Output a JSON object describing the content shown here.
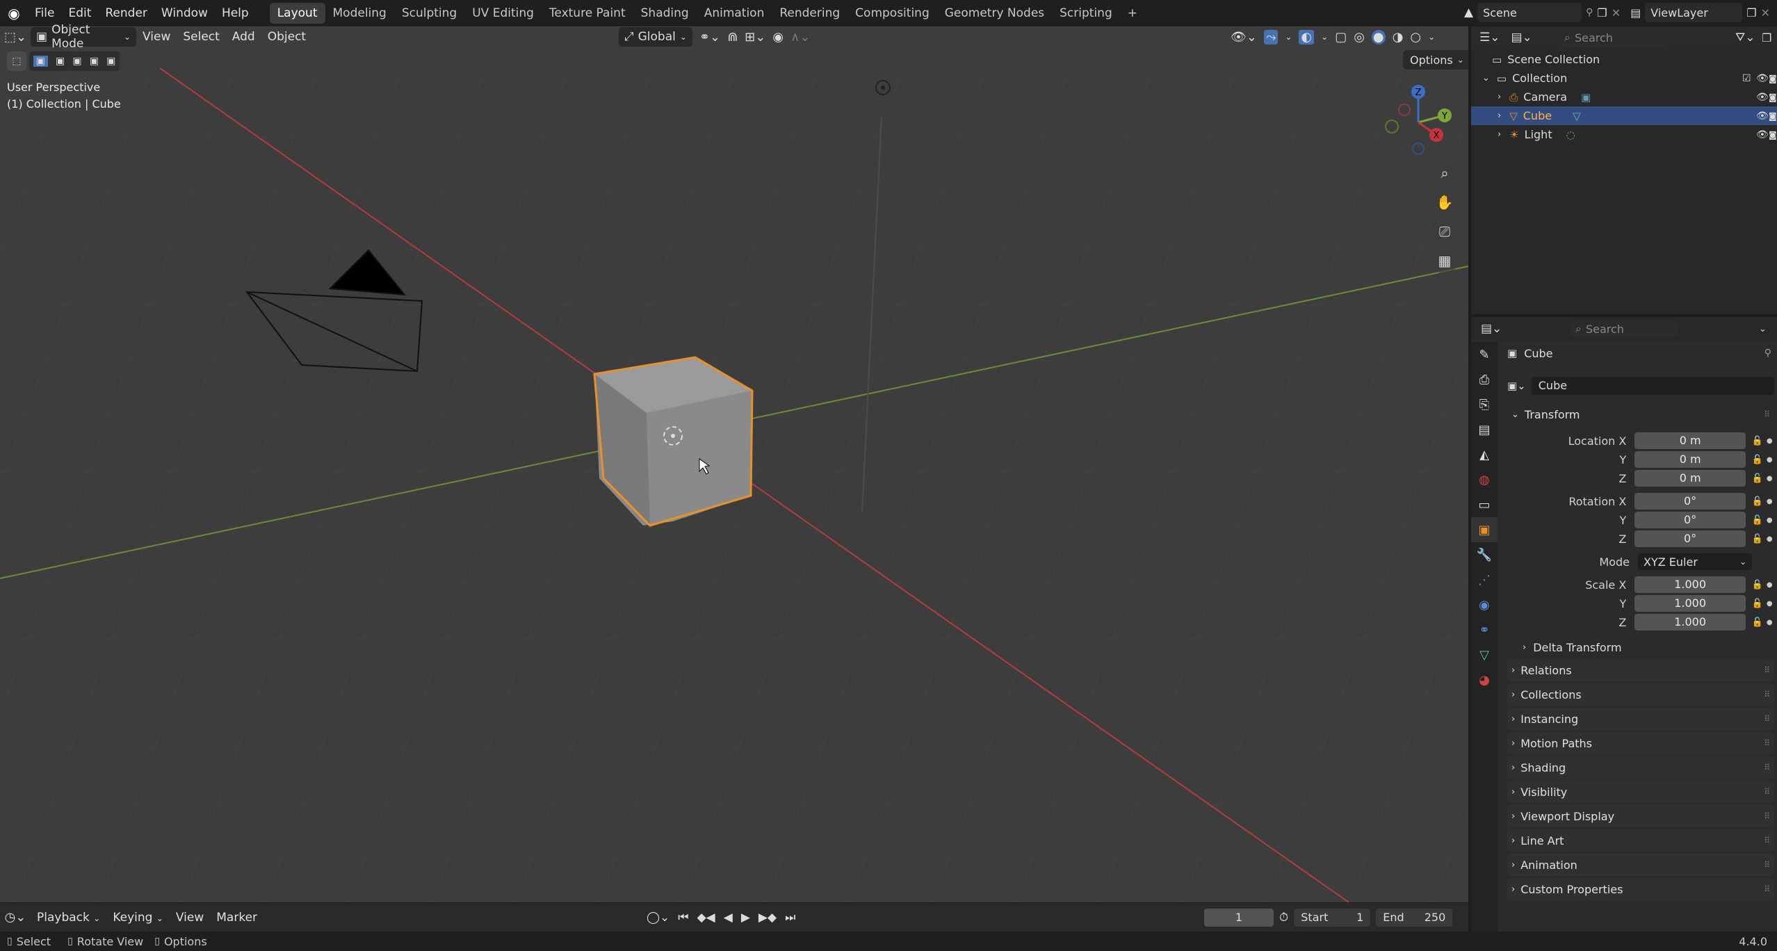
{
  "topbar": {
    "menus": [
      "File",
      "Edit",
      "Render",
      "Window",
      "Help"
    ],
    "workspaces": [
      "Layout",
      "Modeling",
      "Sculpting",
      "UV Editing",
      "Texture Paint",
      "Shading",
      "Animation",
      "Rendering",
      "Compositing",
      "Geometry Nodes",
      "Scripting"
    ],
    "active_workspace": "Layout",
    "add_tab": "+",
    "scene": "Scene",
    "view_layer": "ViewLayer"
  },
  "viewport": {
    "mode": "Object Mode",
    "menus": [
      "View",
      "Select",
      "Add",
      "Object"
    ],
    "orientation": "Global",
    "options": "Options",
    "perspective": "User Perspective",
    "collection_info": "(1) Collection | Cube",
    "gizmo": {
      "z": "Z",
      "y": "Y",
      "x": "X"
    }
  },
  "timeline": {
    "menus": [
      "Playback",
      "Keying",
      "View",
      "Marker"
    ],
    "current_frame": "1",
    "start_label": "Start",
    "start": "1",
    "end_label": "End",
    "end": "250"
  },
  "status": {
    "select": "Select",
    "rotate": "Rotate View",
    "options": "Options",
    "version": "4.4.0"
  },
  "outliner": {
    "search_placeholder": "Search",
    "root": "Scene Collection",
    "collection": "Collection",
    "items": [
      {
        "name": "Camera"
      },
      {
        "name": "Cube"
      },
      {
        "name": "Light"
      }
    ]
  },
  "properties": {
    "search_placeholder": "Search",
    "object_name": "Cube",
    "datablock": "Cube",
    "transform_label": "Transform",
    "location": {
      "label": "Location X",
      "y_label": "Y",
      "z_label": "Z",
      "x": "0 m",
      "y": "0 m",
      "z": "0 m"
    },
    "rotation": {
      "label": "Rotation X",
      "y_label": "Y",
      "z_label": "Z",
      "x": "0°",
      "y": "0°",
      "z": "0°"
    },
    "mode_label": "Mode",
    "mode": "XYZ Euler",
    "scale": {
      "label": "Scale X",
      "y_label": "Y",
      "z_label": "Z",
      "x": "1.000",
      "y": "1.000",
      "z": "1.000"
    },
    "delta": "Delta Transform",
    "panels": [
      "Relations",
      "Collections",
      "Instancing",
      "Motion Paths",
      "Shading",
      "Visibility",
      "Viewport Display",
      "Line Art",
      "Animation",
      "Custom Properties"
    ]
  },
  "colors": {
    "accent": "#4772b3",
    "selection_outline": "#e8902a",
    "x_axis": "#c4343a",
    "y_axis": "#7da63b",
    "z_axis": "#3b6ec4"
  }
}
